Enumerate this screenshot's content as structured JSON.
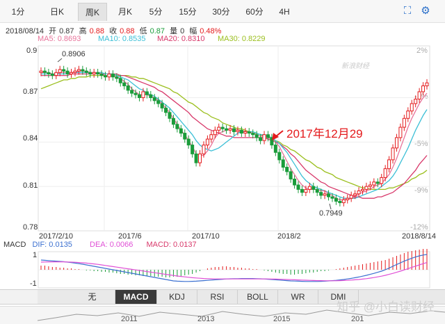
{
  "period_tabs": [
    "1分",
    "日K",
    "周K",
    "月K",
    "5分",
    "15分",
    "30分",
    "60分",
    "4H"
  ],
  "active_tab_index": 2,
  "toolbar_icons": [
    "fullscreen-icon",
    "settings-icon"
  ],
  "quote": {
    "date": "2018/08/14",
    "open_label": "开",
    "open": "0.87",
    "high_label": "高",
    "high": "0.88",
    "close_label": "收",
    "close": "0.88",
    "low_label": "低",
    "low": "0.87",
    "volume_label": "量",
    "volume": "0",
    "change_label": "幅",
    "change": "0.48%"
  },
  "ma_legend": {
    "ma5": "MA5: 0.8693",
    "ma10": "MA10: 0.8535",
    "ma20": "MA20: 0.8310",
    "ma30": "MA30: 0.8229"
  },
  "colors": {
    "up": "#e41a1c",
    "down": "#1a9c3a",
    "ma5": "#e8739a",
    "ma10": "#3bbfd6",
    "ma20": "#d8386a",
    "ma30": "#9bbf1e",
    "dif": "#3a6fd0",
    "dea": "#e04fd6"
  },
  "watermark_sina": "新浪财经",
  "annotation": "2017年12月29",
  "macd_legend": {
    "name": "MACD",
    "dif": "DIF: 0.0135",
    "dea": "DEA: 0.0066",
    "macd": "MACD: 0.0137"
  },
  "indicator_tabs": [
    "无",
    "MACD",
    "KDJ",
    "RSI",
    "BOLL",
    "WR",
    "DMI"
  ],
  "active_indicator_index": 1,
  "year_labels": [
    "2011",
    "2013",
    "2015",
    "201"
  ],
  "watermark_zhihu": "知乎 @小白读财经",
  "chart_data": {
    "type": "candlestick",
    "y_ticks": [
      "0.9",
      "0.87",
      "0.84",
      "0.81",
      "0.78"
    ],
    "pct_ticks": [
      "2%",
      "-1%",
      "-5%",
      "-9%",
      "-12%"
    ],
    "x_ticks": [
      "2017/2/10",
      "2017/6",
      "2017/10",
      "2018/2",
      "2018/8/14"
    ],
    "high_label": "0.8906",
    "low_label": "0.7949",
    "ylim": [
      0.78,
      0.905
    ],
    "macd_ticks": [
      "1",
      "-1"
    ],
    "close": [
      0.888,
      0.887,
      0.886,
      0.885,
      0.887,
      0.889,
      0.888,
      0.886,
      0.887,
      0.888,
      0.889,
      0.888,
      0.887,
      0.886,
      0.887,
      0.886,
      0.885,
      0.884,
      0.886,
      0.884,
      0.883,
      0.88,
      0.878,
      0.875,
      0.873,
      0.872,
      0.87,
      0.874,
      0.872,
      0.87,
      0.868,
      0.866,
      0.863,
      0.86,
      0.856,
      0.852,
      0.849,
      0.846,
      0.842,
      0.838,
      0.832,
      0.826,
      0.832,
      0.838,
      0.842,
      0.845,
      0.848,
      0.85,
      0.849,
      0.848,
      0.849,
      0.847,
      0.848,
      0.846,
      0.847,
      0.846,
      0.845,
      0.843,
      0.841,
      0.845,
      0.843,
      0.838,
      0.833,
      0.828,
      0.823,
      0.82,
      0.815,
      0.811,
      0.808,
      0.806,
      0.808,
      0.81,
      0.808,
      0.806,
      0.804,
      0.805,
      0.803,
      0.802,
      0.8,
      0.799,
      0.801,
      0.802,
      0.804,
      0.805,
      0.807,
      0.808,
      0.81,
      0.811,
      0.813,
      0.812,
      0.816,
      0.822,
      0.828,
      0.836,
      0.843,
      0.85,
      0.856,
      0.861,
      0.866,
      0.869,
      0.874,
      0.878,
      0.88
    ],
    "ma5": [
      0.887,
      0.887,
      0.887,
      0.886,
      0.886,
      0.887,
      0.887,
      0.887,
      0.887,
      0.887,
      0.888,
      0.888,
      0.888,
      0.887,
      0.887,
      0.887,
      0.886,
      0.885,
      0.885,
      0.885,
      0.884,
      0.883,
      0.881,
      0.879,
      0.876,
      0.874,
      0.872,
      0.872,
      0.872,
      0.871,
      0.87,
      0.868,
      0.866,
      0.863,
      0.86,
      0.856,
      0.852,
      0.848,
      0.845,
      0.841,
      0.837,
      0.832,
      0.831,
      0.831,
      0.834,
      0.838,
      0.843,
      0.846,
      0.847,
      0.848,
      0.849,
      0.849,
      0.848,
      0.848,
      0.847,
      0.847,
      0.846,
      0.845,
      0.844,
      0.844,
      0.843,
      0.842,
      0.84,
      0.837,
      0.832,
      0.827,
      0.822,
      0.818,
      0.814,
      0.811,
      0.809,
      0.808,
      0.808,
      0.808,
      0.807,
      0.807,
      0.805,
      0.804,
      0.802,
      0.801,
      0.801,
      0.801,
      0.802,
      0.803,
      0.805,
      0.806,
      0.807,
      0.808,
      0.81,
      0.811,
      0.812,
      0.815,
      0.818,
      0.823,
      0.829,
      0.836,
      0.843,
      0.85,
      0.856,
      0.861,
      0.866,
      0.87,
      0.873
    ],
    "ma10": [
      0.886,
      0.886,
      0.886,
      0.886,
      0.886,
      0.886,
      0.886,
      0.886,
      0.887,
      0.887,
      0.887,
      0.887,
      0.887,
      0.887,
      0.887,
      0.887,
      0.887,
      0.886,
      0.886,
      0.886,
      0.885,
      0.884,
      0.883,
      0.882,
      0.88,
      0.878,
      0.876,
      0.875,
      0.873,
      0.872,
      0.871,
      0.869,
      0.867,
      0.865,
      0.863,
      0.86,
      0.857,
      0.854,
      0.851,
      0.848,
      0.845,
      0.841,
      0.838,
      0.836,
      0.835,
      0.834,
      0.835,
      0.836,
      0.838,
      0.84,
      0.842,
      0.844,
      0.846,
      0.847,
      0.847,
      0.847,
      0.847,
      0.846,
      0.845,
      0.845,
      0.844,
      0.843,
      0.841,
      0.839,
      0.836,
      0.833,
      0.829,
      0.825,
      0.821,
      0.817,
      0.814,
      0.812,
      0.81,
      0.809,
      0.808,
      0.807,
      0.806,
      0.805,
      0.804,
      0.803,
      0.802,
      0.802,
      0.802,
      0.802,
      0.803,
      0.804,
      0.805,
      0.806,
      0.807,
      0.808,
      0.81,
      0.812,
      0.814,
      0.817,
      0.821,
      0.826,
      0.831,
      0.836,
      0.842,
      0.848,
      0.853,
      0.858,
      0.862
    ],
    "ma20": [
      0.885,
      0.885,
      0.885,
      0.885,
      0.885,
      0.885,
      0.885,
      0.885,
      0.886,
      0.886,
      0.886,
      0.886,
      0.886,
      0.886,
      0.886,
      0.886,
      0.886,
      0.886,
      0.886,
      0.886,
      0.886,
      0.885,
      0.885,
      0.884,
      0.883,
      0.882,
      0.881,
      0.88,
      0.879,
      0.878,
      0.877,
      0.875,
      0.874,
      0.872,
      0.87,
      0.868,
      0.866,
      0.864,
      0.862,
      0.86,
      0.857,
      0.855,
      0.853,
      0.851,
      0.849,
      0.848,
      0.847,
      0.846,
      0.845,
      0.844,
      0.844,
      0.843,
      0.843,
      0.843,
      0.843,
      0.843,
      0.843,
      0.843,
      0.843,
      0.843,
      0.842,
      0.841,
      0.84,
      0.839,
      0.837,
      0.835,
      0.832,
      0.83,
      0.827,
      0.824,
      0.821,
      0.819,
      0.817,
      0.815,
      0.813,
      0.812,
      0.81,
      0.809,
      0.808,
      0.807,
      0.806,
      0.805,
      0.804,
      0.803,
      0.803,
      0.802,
      0.802,
      0.802,
      0.802,
      0.803,
      0.803,
      0.804,
      0.805,
      0.806,
      0.808,
      0.81,
      0.812,
      0.815,
      0.818,
      0.821,
      0.825,
      0.828,
      0.831
    ],
    "ma30": [
      0.876,
      0.877,
      0.878,
      0.879,
      0.88,
      0.881,
      0.882,
      0.882,
      0.883,
      0.883,
      0.884,
      0.884,
      0.884,
      0.885,
      0.885,
      0.885,
      0.885,
      0.885,
      0.885,
      0.885,
      0.885,
      0.885,
      0.885,
      0.885,
      0.884,
      0.884,
      0.883,
      0.883,
      0.882,
      0.881,
      0.88,
      0.879,
      0.878,
      0.877,
      0.876,
      0.874,
      0.873,
      0.871,
      0.869,
      0.867,
      0.866,
      0.864,
      0.862,
      0.86,
      0.859,
      0.857,
      0.856,
      0.855,
      0.853,
      0.852,
      0.851,
      0.85,
      0.849,
      0.849,
      0.848,
      0.847,
      0.846,
      0.846,
      0.845,
      0.844,
      0.843,
      0.842,
      0.841,
      0.84,
      0.838,
      0.837,
      0.835,
      0.834,
      0.832,
      0.83,
      0.828,
      0.827,
      0.825,
      0.823,
      0.822,
      0.82,
      0.819,
      0.818,
      0.816,
      0.815,
      0.814,
      0.813,
      0.812,
      0.811,
      0.81,
      0.809,
      0.809,
      0.808,
      0.808,
      0.808,
      0.808,
      0.808,
      0.809,
      0.809,
      0.81,
      0.811,
      0.812,
      0.813,
      0.815,
      0.816,
      0.818,
      0.819,
      0.821
    ],
    "macd_hist": [
      0.3,
      0.3,
      0.25,
      0.2,
      0.2,
      0.15,
      0.15,
      0.1,
      0.1,
      0.05,
      0.05,
      0.0,
      -0.05,
      -0.05,
      -0.1,
      -0.1,
      -0.15,
      -0.15,
      -0.2,
      -0.2,
      -0.25,
      -0.3,
      -0.3,
      -0.35,
      -0.35,
      -0.4,
      -0.4,
      -0.45,
      -0.45,
      -0.45,
      -0.5,
      -0.5,
      -0.5,
      -0.55,
      -0.55,
      -0.5,
      -0.5,
      -0.45,
      -0.4,
      -0.35,
      -0.3,
      -0.2,
      -0.1,
      0.0,
      0.1,
      0.15,
      0.2,
      0.2,
      0.25,
      0.25,
      0.2,
      0.2,
      0.15,
      0.15,
      0.1,
      0.1,
      0.05,
      0.05,
      0.0,
      -0.05,
      -0.1,
      -0.15,
      -0.2,
      -0.25,
      -0.3,
      -0.3,
      -0.35,
      -0.35,
      -0.3,
      -0.3,
      -0.25,
      -0.2,
      -0.2,
      -0.15,
      -0.1,
      -0.1,
      -0.05,
      0.0,
      0.05,
      0.1,
      0.15,
      0.2,
      0.25,
      0.3,
      0.35,
      0.4,
      0.45,
      0.5,
      0.55,
      0.6,
      0.65,
      0.7,
      0.8,
      0.9,
      1.0,
      1.1,
      1.2,
      1.3,
      1.35,
      1.4,
      1.45,
      1.5,
      1.5
    ],
    "dif": [
      0.7,
      0.68,
      0.66,
      0.64,
      0.62,
      0.6,
      0.58,
      0.55,
      0.52,
      0.48,
      0.44,
      0.4,
      0.35,
      0.3,
      0.25,
      0.2,
      0.15,
      0.1,
      0.05,
      0.0,
      -0.05,
      -0.1,
      -0.15,
      -0.2,
      -0.25,
      -0.3,
      -0.35,
      -0.4,
      -0.45,
      -0.5,
      -0.55,
      -0.6,
      -0.65,
      -0.7,
      -0.75,
      -0.8,
      -0.82,
      -0.83,
      -0.84,
      -0.84,
      -0.83,
      -0.82,
      -0.8,
      -0.78,
      -0.76,
      -0.74,
      -0.72,
      -0.7,
      -0.68,
      -0.66,
      -0.65,
      -0.64,
      -0.64,
      -0.63,
      -0.63,
      -0.63,
      -0.63,
      -0.64,
      -0.65,
      -0.66,
      -0.68,
      -0.7,
      -0.72,
      -0.74,
      -0.76,
      -0.78,
      -0.8,
      -0.81,
      -0.82,
      -0.83,
      -0.84,
      -0.84,
      -0.84,
      -0.84,
      -0.83,
      -0.82,
      -0.8,
      -0.78,
      -0.76,
      -0.73,
      -0.7,
      -0.66,
      -0.62,
      -0.57,
      -0.52,
      -0.46,
      -0.4,
      -0.33,
      -0.26,
      -0.18,
      -0.1,
      0.0,
      0.12,
      0.25,
      0.38,
      0.5,
      0.62,
      0.73,
      0.83,
      0.92,
      1.0,
      1.06,
      1.1
    ],
    "dea": [
      0.55,
      0.56,
      0.57,
      0.57,
      0.57,
      0.57,
      0.57,
      0.56,
      0.55,
      0.54,
      0.52,
      0.5,
      0.48,
      0.45,
      0.42,
      0.39,
      0.35,
      0.31,
      0.27,
      0.23,
      0.19,
      0.15,
      0.11,
      0.07,
      0.03,
      -0.01,
      -0.05,
      -0.09,
      -0.13,
      -0.17,
      -0.21,
      -0.25,
      -0.29,
      -0.33,
      -0.37,
      -0.41,
      -0.45,
      -0.48,
      -0.51,
      -0.54,
      -0.57,
      -0.59,
      -0.61,
      -0.63,
      -0.64,
      -0.65,
      -0.66,
      -0.66,
      -0.66,
      -0.66,
      -0.66,
      -0.66,
      -0.66,
      -0.66,
      -0.66,
      -0.66,
      -0.66,
      -0.66,
      -0.66,
      -0.66,
      -0.66,
      -0.67,
      -0.67,
      -0.68,
      -0.69,
      -0.7,
      -0.71,
      -0.72,
      -0.73,
      -0.74,
      -0.75,
      -0.76,
      -0.77,
      -0.78,
      -0.78,
      -0.79,
      -0.79,
      -0.79,
      -0.79,
      -0.78,
      -0.77,
      -0.76,
      -0.74,
      -0.72,
      -0.7,
      -0.67,
      -0.64,
      -0.6,
      -0.56,
      -0.51,
      -0.46,
      -0.4,
      -0.33,
      -0.26,
      -0.18,
      -0.1,
      -0.01,
      0.08,
      0.17,
      0.26,
      0.35,
      0.44,
      0.52
    ]
  }
}
